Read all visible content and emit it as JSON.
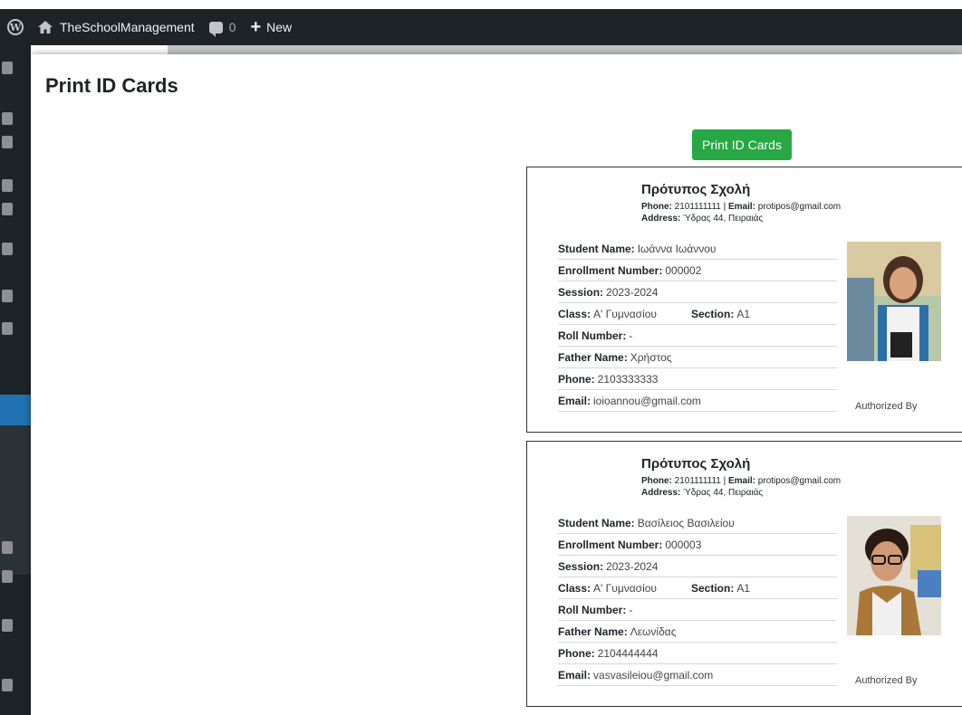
{
  "adminbar": {
    "site_name": "TheSchoolManagement",
    "comments_count": "0",
    "new_label": "New"
  },
  "modal": {
    "title": "Print ID Cards",
    "print_button": "Print ID Cards"
  },
  "cards": [
    {
      "school_name": "Πρότυπος Σχολή",
      "phone_label": "Phone:",
      "phone": "2101111111",
      "email_label": "Email:",
      "email": "protipos@gmail.com",
      "address_label": "Address:",
      "address": "Ύδρας 44, Πειραιάς",
      "student_name_label": "Student Name:",
      "student_name": "Ιωάννα Ιωάννου",
      "enrollment_label": "Enrollment Number:",
      "enrollment": "000002",
      "session_label": "Session:",
      "session": "2023-2024",
      "class_label": "Class:",
      "class": "Α' Γυμνασίου",
      "section_label": "Section:",
      "section": "A1",
      "roll_label": "Roll Number:",
      "roll": "-",
      "father_label": "Father Name:",
      "father": "Χρήστος",
      "student_phone_label": "Phone:",
      "student_phone": "2103333333",
      "student_email_label": "Email:",
      "student_email": "ioioannou@gmail.com",
      "authorized": "Authorized By"
    },
    {
      "school_name": "Πρότυπος Σχολή",
      "phone_label": "Phone:",
      "phone": "2101111111",
      "email_label": "Email:",
      "email": "protipos@gmail.com",
      "address_label": "Address:",
      "address": "Ύδρας 44, Πειραιάς",
      "student_name_label": "Student Name:",
      "student_name": "Βασίλειος Βασιλείου",
      "enrollment_label": "Enrollment Number:",
      "enrollment": "000003",
      "session_label": "Session:",
      "session": "2023-2024",
      "class_label": "Class:",
      "class": "Α' Γυμνασίου",
      "section_label": "Section:",
      "section": "A1",
      "roll_label": "Roll Number:",
      "roll": "-",
      "father_label": "Father Name:",
      "father": "Λεωνίδας",
      "student_phone_label": "Phone:",
      "student_phone": "2104444444",
      "student_email_label": "Email:",
      "student_email": "vasvasileiou@gmail.com",
      "authorized": "Authorized By"
    }
  ]
}
